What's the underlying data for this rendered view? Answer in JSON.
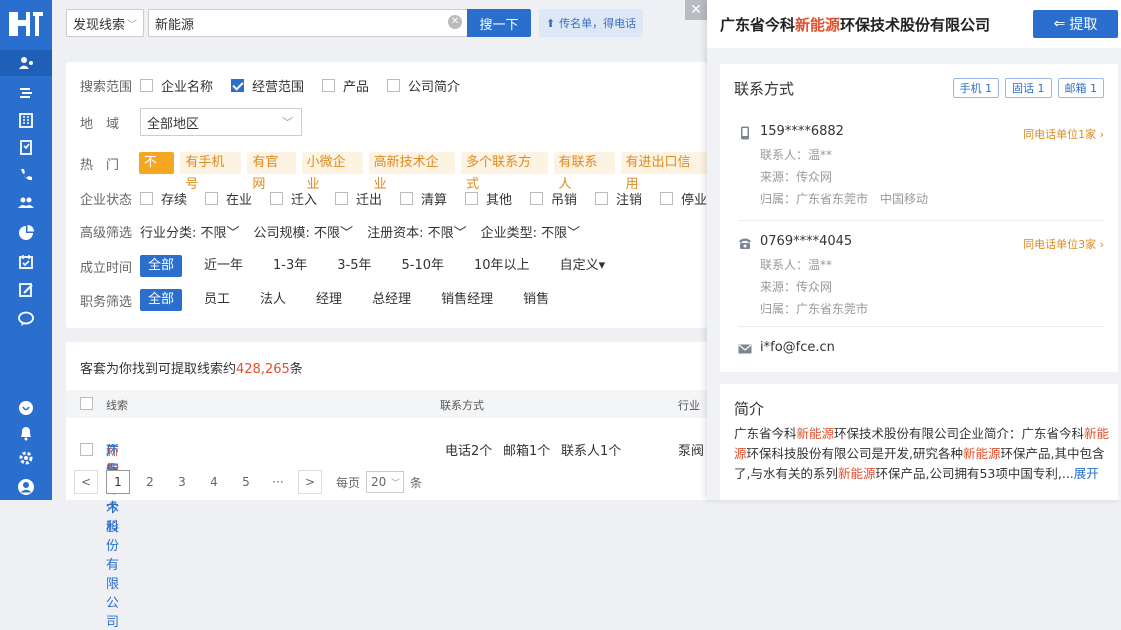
{
  "topbar": {
    "search_type": "发现线索",
    "search_value": "新能源",
    "search_button": "搜一下",
    "upload_label": "传名单，得电话"
  },
  "filters": {
    "scope_label": "搜索范围",
    "scope_options": [
      {
        "label": "企业名称",
        "checked": false
      },
      {
        "label": "经营范围",
        "checked": true
      },
      {
        "label": "产品",
        "checked": false
      },
      {
        "label": "公司简介",
        "checked": false
      }
    ],
    "region_label": "地　域",
    "region_value": "全部地区",
    "hot_label": "热　门",
    "hot_tags": [
      "不限",
      "有手机号",
      "有官网",
      "小微企业",
      "高新技术企业",
      "多个联系方式",
      "有联系人",
      "有进出口信用"
    ],
    "status_label": "企业状态",
    "status_options": [
      "存续",
      "在业",
      "迁入",
      "迁出",
      "清算",
      "其他",
      "吊销",
      "注销",
      "停业"
    ],
    "advanced_label": "高级筛选",
    "advanced_dropdowns": [
      "行业分类: 不限",
      "公司规模: 不限",
      "注册资本: 不限",
      "企业类型: 不限"
    ],
    "established_label": "成立时间",
    "established_options": [
      "全部",
      "近一年",
      "1-3年",
      "3-5年",
      "5-10年",
      "10年以上",
      "自定义"
    ],
    "position_label": "职务筛选",
    "position_options": [
      "全部",
      "员工",
      "法人",
      "经理",
      "总经理",
      "销售经理",
      "销售"
    ]
  },
  "results": {
    "summary_prefix": "客套为你找到可提取线索约",
    "summary_count": "428,265",
    "summary_suffix": "条",
    "columns": [
      "线索",
      "联系方式",
      "行业"
    ],
    "row": {
      "company_pre": "广东省今科",
      "company_hl": "新能源",
      "company_post": "环保技术股份有限公司",
      "phone": "电话2个",
      "email": "邮箱1个",
      "contact": "联系人1个",
      "industry": "泵阀"
    },
    "pager": {
      "pages": [
        "1",
        "2",
        "3",
        "4",
        "5",
        "···"
      ],
      "prev": "<",
      "next": ">",
      "per_page_label": "每页",
      "per_page_value": "20",
      "unit": "条"
    }
  },
  "drawer": {
    "title_pre": "广东省今科",
    "title_hl": "新能源",
    "title_post": "环保技术股份有限公司",
    "extract_button": "提取",
    "contact_title": "联系方式",
    "badges": [
      "手机 1",
      "固话 1",
      "邮箱 1"
    ],
    "mobile": {
      "number": "159****6882",
      "same_unit": "同电话单位1家",
      "contact": "联系人：温**",
      "source": "来源：传众网",
      "location": "归属：广东省东莞市　中国移动"
    },
    "landline": {
      "number": "0769****4045",
      "same_unit": "同电话单位3家",
      "contact": "联系人：温**",
      "source": "来源：传众网",
      "location": "归属：广东省东莞市"
    },
    "email": "i*fo@fce.cn",
    "intro_title": "简介",
    "intro": {
      "p1": "广东省今科",
      "h1": "新能源",
      "p2": "环保技术股份有限公司企业简介：广东省今科",
      "h2": "新能源",
      "p3": "环保科技股份有限公司是开发,研究各种",
      "h3": "新能源",
      "p4": "环保产品,其中包含了,与水有关的系列",
      "h4": "新能源",
      "p5": "环保产品,公司拥有53项中国专利,...",
      "more": "展开"
    }
  }
}
